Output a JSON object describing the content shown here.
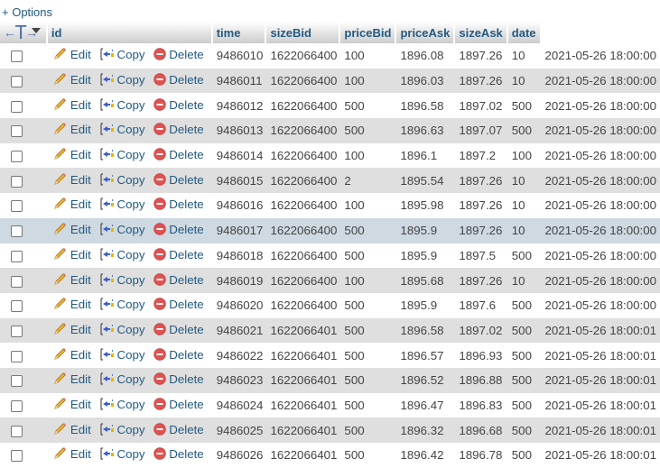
{
  "options_link": "+ Options",
  "header": {
    "ctrl_arrows": {
      "left": "←",
      "bar": "T",
      "right": "→"
    },
    "columns": [
      "id",
      "time",
      "sizeBid",
      "priceBid",
      "priceAsk",
      "sizeAsk",
      "date"
    ]
  },
  "actions": {
    "edit": "Edit",
    "copy": "Copy",
    "delete": "Delete"
  },
  "colors": {
    "link": "#235a81",
    "row_alt": "#dfdfdf",
    "row_highlight": "#ced9e1"
  },
  "highlighted_row": 7,
  "rows": [
    {
      "id": "9486010",
      "time": "1622066400",
      "sizeBid": "100",
      "priceBid": "1896.08",
      "priceAsk": "1897.26",
      "sizeAsk": "10",
      "date": "2021-05-26 18:00:00"
    },
    {
      "id": "9486011",
      "time": "1622066400",
      "sizeBid": "100",
      "priceBid": "1896.03",
      "priceAsk": "1897.26",
      "sizeAsk": "10",
      "date": "2021-05-26 18:00:00"
    },
    {
      "id": "9486012",
      "time": "1622066400",
      "sizeBid": "500",
      "priceBid": "1896.58",
      "priceAsk": "1897.02",
      "sizeAsk": "500",
      "date": "2021-05-26 18:00:00"
    },
    {
      "id": "9486013",
      "time": "1622066400",
      "sizeBid": "500",
      "priceBid": "1896.63",
      "priceAsk": "1897.07",
      "sizeAsk": "500",
      "date": "2021-05-26 18:00:00"
    },
    {
      "id": "9486014",
      "time": "1622066400",
      "sizeBid": "100",
      "priceBid": "1896.1",
      "priceAsk": "1897.2",
      "sizeAsk": "100",
      "date": "2021-05-26 18:00:00"
    },
    {
      "id": "9486015",
      "time": "1622066400",
      "sizeBid": "2",
      "priceBid": "1895.54",
      "priceAsk": "1897.26",
      "sizeAsk": "10",
      "date": "2021-05-26 18:00:00"
    },
    {
      "id": "9486016",
      "time": "1622066400",
      "sizeBid": "100",
      "priceBid": "1895.98",
      "priceAsk": "1897.26",
      "sizeAsk": "10",
      "date": "2021-05-26 18:00:00"
    },
    {
      "id": "9486017",
      "time": "1622066400",
      "sizeBid": "500",
      "priceBid": "1895.9",
      "priceAsk": "1897.26",
      "sizeAsk": "10",
      "date": "2021-05-26 18:00:00"
    },
    {
      "id": "9486018",
      "time": "1622066400",
      "sizeBid": "500",
      "priceBid": "1895.9",
      "priceAsk": "1897.5",
      "sizeAsk": "500",
      "date": "2021-05-26 18:00:00"
    },
    {
      "id": "9486019",
      "time": "1622066400",
      "sizeBid": "100",
      "priceBid": "1895.68",
      "priceAsk": "1897.26",
      "sizeAsk": "10",
      "date": "2021-05-26 18:00:00"
    },
    {
      "id": "9486020",
      "time": "1622066400",
      "sizeBid": "500",
      "priceBid": "1895.9",
      "priceAsk": "1897.6",
      "sizeAsk": "500",
      "date": "2021-05-26 18:00:00"
    },
    {
      "id": "9486021",
      "time": "1622066401",
      "sizeBid": "500",
      "priceBid": "1896.58",
      "priceAsk": "1897.02",
      "sizeAsk": "500",
      "date": "2021-05-26 18:00:01"
    },
    {
      "id": "9486022",
      "time": "1622066401",
      "sizeBid": "500",
      "priceBid": "1896.57",
      "priceAsk": "1896.93",
      "sizeAsk": "500",
      "date": "2021-05-26 18:00:01"
    },
    {
      "id": "9486023",
      "time": "1622066401",
      "sizeBid": "500",
      "priceBid": "1896.52",
      "priceAsk": "1896.88",
      "sizeAsk": "500",
      "date": "2021-05-26 18:00:01"
    },
    {
      "id": "9486024",
      "time": "1622066401",
      "sizeBid": "500",
      "priceBid": "1896.47",
      "priceAsk": "1896.83",
      "sizeAsk": "500",
      "date": "2021-05-26 18:00:01"
    },
    {
      "id": "9486025",
      "time": "1622066401",
      "sizeBid": "500",
      "priceBid": "1896.32",
      "priceAsk": "1896.68",
      "sizeAsk": "500",
      "date": "2021-05-26 18:00:01"
    },
    {
      "id": "9486026",
      "time": "1622066401",
      "sizeBid": "500",
      "priceBid": "1896.42",
      "priceAsk": "1896.78",
      "sizeAsk": "500",
      "date": "2021-05-26 18:00:01"
    }
  ]
}
